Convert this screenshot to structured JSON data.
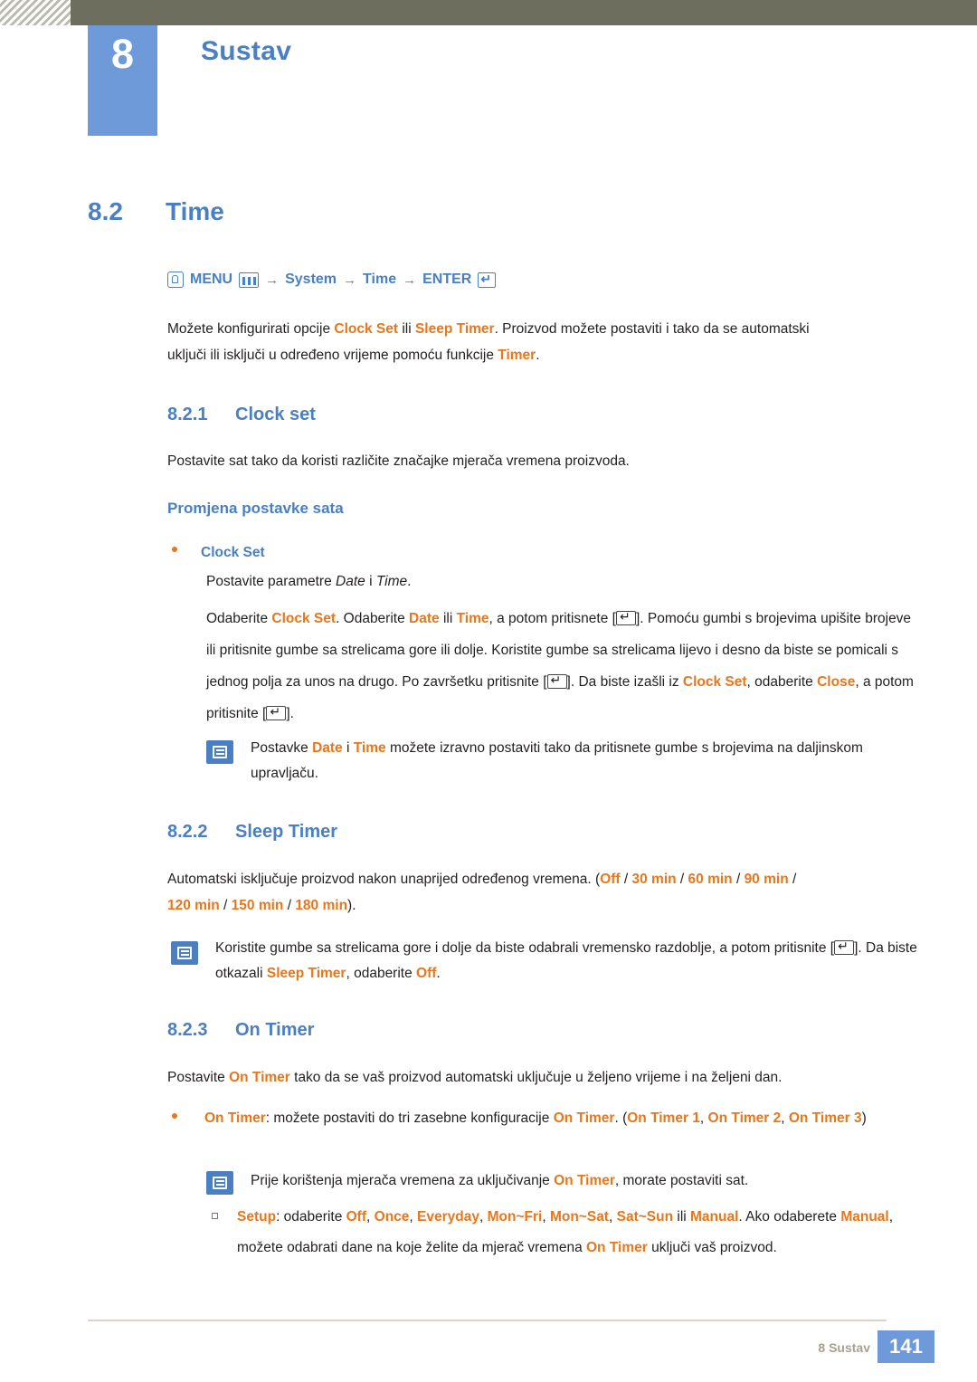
{
  "header": {
    "chapter_number": "8",
    "chapter_title": "Sustav"
  },
  "section": {
    "number": "8.2",
    "title": "Time"
  },
  "menu_path": {
    "menu_label": "MENU",
    "arrow1": "→",
    "item1": "System",
    "arrow2": "→",
    "item2": "Time",
    "arrow3": "→",
    "enter_label": "ENTER"
  },
  "intro": {
    "line1_a": "Možete konfigurirati opcije ",
    "line1_b": "Clock Set",
    "line1_c": " ili ",
    "line1_d": "Sleep Timer",
    "line1_e": ". Proizvod možete postaviti i tako da se automatski",
    "line2_a": "uključi ili isključi u određeno vrijeme pomoću funkcije ",
    "line2_b": "Timer",
    "line2_c": "."
  },
  "clock_set": {
    "number": "8.2.1",
    "title": "Clock set",
    "intro": "Postavite sat tako da koristi različite značajke mjerača vremena proizvoda.",
    "subhead": "Promjena postavke sata",
    "bullet_label": "Clock Set",
    "b1_a": "Postavite parametre ",
    "b1_b": "Date",
    "b1_c": " i ",
    "b1_d": "Time",
    "b1_e": ".",
    "p_l1_a": "Odaberite ",
    "p_l1_b": "Clock Set",
    "p_l1_c": ". Odaberite ",
    "p_l1_d": "Date",
    "p_l1_e": " ili ",
    "p_l1_f": "Time",
    "p_l1_g": ", a potom pritisnete [",
    "p_l1_h": "]. Pomoću gumbi s brojevima",
    "p_l2": "upišite brojeve ili pritisnite gumbe sa strelicama gore ili dolje. Koristite gumbe sa strelicama lijevo i",
    "p_l3_a": "desno da biste se pomicali s jednog polja za unos na drugo. Po završetku pritisnite [",
    "p_l3_b": "]. Da biste",
    "p_l4_a": "izašli iz ",
    "p_l4_b": "Clock Set",
    "p_l4_c": ", odaberite ",
    "p_l4_d": "Close",
    "p_l4_e": ", a potom pritisnite [",
    "p_l4_f": "].",
    "note_l1_a": "Postavke ",
    "note_l1_b": "Date",
    "note_l1_c": " i ",
    "note_l1_d": "Time",
    "note_l1_e": " možete izravno postaviti tako da pritisnete gumbe s brojevima na daljinskom",
    "note_l2": "upravljaču."
  },
  "sleep_timer": {
    "number": "8.2.2",
    "title": "Sleep Timer",
    "l1_a": "Automatski isključuje proizvod nakon unaprijed određenog vremena. (",
    "l1_opt1": "Off",
    "l1_sep1": " / ",
    "l1_opt2": "30 min",
    "l1_sep2": " / ",
    "l1_opt3": "60 min",
    "l1_sep3": " / ",
    "l1_opt4": "90 min",
    "l1_sep4": " /",
    "l2_opt5": "120 min",
    "l2_sep5": " / ",
    "l2_opt6": "150 min",
    "l2_sep6": " / ",
    "l2_opt7": "180 min",
    "l2_end": ").",
    "note_l1": "Koristite gumbe sa strelicama gore i dolje da biste odabrali vremensko razdoblje, a potom pritisnite",
    "note_l2_a": "[",
    "note_l2_b": "]. Da biste otkazali ",
    "note_l2_c": "Sleep Timer",
    "note_l2_d": ", odaberite ",
    "note_l2_e": "Off",
    "note_l2_f": "."
  },
  "on_timer": {
    "number": "8.2.3",
    "title": "On Timer",
    "intro_a": "Postavite ",
    "intro_b": "On Timer",
    "intro_c": " tako da se vaš proizvod automatski uključuje u željeno vrijeme i na željeni dan.",
    "b1_a": "On Timer",
    "b1_b": ": možete postaviti do tri zasebne konfiguracije ",
    "b1_c": "On Timer",
    "b1_d": ". (",
    "b1_e": "On Timer 1",
    "b1_f": ", ",
    "b1_g": "On Timer 2",
    "b1_h": ", ",
    "b1_i": "On",
    "b1_j": "Timer 3",
    "b1_k": ")",
    "note_a": "Prije korištenja mjerača vremena za uključivanje ",
    "note_b": "On Timer",
    "note_c": ", morate postaviti sat.",
    "setup_a": "Setup",
    "setup_b": ": odaberite ",
    "setup_c": "Off",
    "setup_d": ", ",
    "setup_e": "Once",
    "setup_f": ", ",
    "setup_g": "Everyday",
    "setup_h": ", ",
    "setup_i": "Mon~Fri",
    "setup_j": ", ",
    "setup_k": "Mon~Sat",
    "setup_l": ", ",
    "setup_m": "Sat~Sun",
    "setup_n": " ili ",
    "setup_o": "Manual",
    "setup_p": ". Ako",
    "setup_l2_a": "odaberete ",
    "setup_l2_b": "Manual",
    "setup_l2_c": ", možete odabrati dane na koje želite da mjerač vremena ",
    "setup_l2_d": "On Timer",
    "setup_l2_e": " uključi",
    "setup_l3": "vaš proizvod."
  },
  "footer": {
    "label": "8 Sustav",
    "page": "141"
  }
}
